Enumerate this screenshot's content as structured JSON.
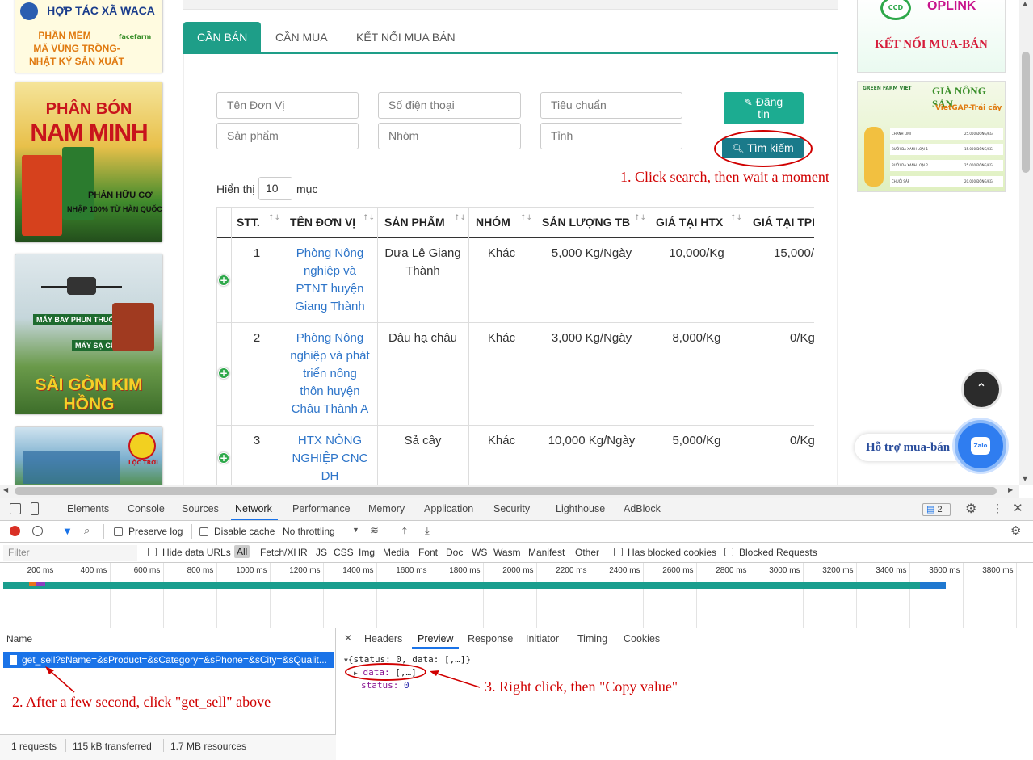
{
  "left_banners": [
    {
      "lines": [
        "HỢP TÁC XÃ WACA",
        "PHẦN MỀM",
        "MÃ VÙNG TRỒNG-",
        "NHẬT KÝ SẢN XUẤT",
        "facefarm"
      ]
    },
    {
      "lines": [
        "PHÂN BÓN",
        "NAM MINH",
        "PHÂN HỮU CƠ",
        "NHẬP 100% TỪ HÀN QUỐC"
      ]
    },
    {
      "lines": [
        "MÁY BAY PHUN THUỐC",
        "MÁY SẠ CỤM",
        "SÀI GÒN KIM HỒNG"
      ]
    },
    {
      "lines": [
        "LỘC TRỜI"
      ]
    }
  ],
  "right_banners": [
    {
      "lines": [
        "CCD",
        "OPLINK",
        "KẾT NỐI MUA-BÁN"
      ]
    },
    {
      "lines": [
        "GREEN FARM VIET",
        "GIÁ NÔNG SẢN",
        "VietGAP-Trái cây",
        "CHANH LIMI",
        "BƯỞI DA XANH LOẠI 1",
        "BƯỞI DA XANH LOẠI 2",
        "CHUỐI SÁP",
        "25.000 ĐỒNG/KG",
        "15.000 ĐỒNG/KG",
        "25.000 ĐỒNG/KG",
        "20.000 ĐỒNG/KG"
      ]
    }
  ],
  "tabs": [
    {
      "label": "CẦN BÁN",
      "active": true
    },
    {
      "label": "CẦN MUA",
      "active": false
    },
    {
      "label": "KẾT NỐI MUA BÁN",
      "active": false
    }
  ],
  "filters": {
    "unit_name": "Tên Đơn Vị",
    "phone": "Số điện thoại",
    "standard": "Tiêu chuẩn",
    "product": "Sản phẩm",
    "group": "Nhóm",
    "province": "Tỉnh"
  },
  "buttons": {
    "post_line1": "Đăng",
    "post_line2": "tin",
    "search": "Tìm kiếm"
  },
  "length_menu": {
    "prefix": "Hiển thị",
    "value": "10",
    "suffix": "mục"
  },
  "table": {
    "headers": [
      "STT.",
      "TÊN ĐƠN VỊ",
      "SẢN PHẨM",
      "NHÓM",
      "SẢN LƯỢNG TB",
      "GIÁ TẠI HTX",
      "GIÁ TẠI TPH"
    ],
    "rows": [
      {
        "stt": "1",
        "unit": [
          "Phòng Nông",
          "nghiệp và",
          "PTNT huyện",
          "Giang Thành"
        ],
        "product": [
          "Dưa Lê Giang",
          "Thành"
        ],
        "group": "Khác",
        "output": "5,000 Kg/Ngày",
        "price_htx": "10,000/Kg",
        "price_tph": "15,000/"
      },
      {
        "stt": "2",
        "unit": [
          "Phòng Nông",
          "nghiệp và phát",
          "triển nông",
          "thôn huyện",
          "Châu Thành A"
        ],
        "product": [
          "Dâu hạ châu"
        ],
        "group": "Khác",
        "output": "3,000 Kg/Ngày",
        "price_htx": "8,000/Kg",
        "price_tph": "0/Kg"
      },
      {
        "stt": "3",
        "unit": [
          "HTX NÔNG",
          "NGHIỆP CNC",
          "DH"
        ],
        "product": [
          "Sả cây"
        ],
        "group": "Khác",
        "output": "10,000 Kg/Ngày",
        "price_htx": "5,000/Kg",
        "price_tph": "0/Kg"
      }
    ]
  },
  "annotations": {
    "a1": "1. Click search, then wait a moment",
    "a2": "2. After a few second, click \"get_sell\" above",
    "a3": "3. Right click, then \"Copy value\""
  },
  "floating": {
    "support_label": "Hỗ trợ mua-bán",
    "zalo": "Zalo"
  },
  "devtools": {
    "tabs": [
      "Elements",
      "Console",
      "Sources",
      "Network",
      "Performance",
      "Memory",
      "Application",
      "Security",
      "Lighthouse",
      "AdBlock"
    ],
    "active_tab": "Network",
    "issues_count": "2",
    "toolbar": {
      "preserve_log": "Preserve log",
      "disable_cache": "Disable cache",
      "throttling": "No throttling"
    },
    "filter_placeholder": "Filter",
    "filter_types": [
      "Hide data URLs",
      "All",
      "Fetch/XHR",
      "JS",
      "CSS",
      "Img",
      "Media",
      "Font",
      "Doc",
      "WS",
      "Wasm",
      "Manifest",
      "Other"
    ],
    "blocked_cookies": "Has blocked cookies",
    "blocked_requests": "Blocked Requests",
    "ticks": [
      "200 ms",
      "400 ms",
      "600 ms",
      "800 ms",
      "1000 ms",
      "1200 ms",
      "1400 ms",
      "1600 ms",
      "1800 ms",
      "2000 ms",
      "2200 ms",
      "2400 ms",
      "2600 ms",
      "2800 ms",
      "3000 ms",
      "3200 ms",
      "3400 ms",
      "3600 ms",
      "3800 ms"
    ],
    "name_header": "Name",
    "request_name": "get_sell?sName=&sProduct=&sCategory=&sPhone=&sCity=&sQualit...",
    "detail_tabs": [
      "Headers",
      "Preview",
      "Response",
      "Initiator",
      "Timing",
      "Cookies"
    ],
    "detail_active": "Preview",
    "preview": {
      "root": "{status: 0, data: [,…]}",
      "data_key": "data",
      "data_val": "[,…]",
      "status_key": "status",
      "status_val": "0"
    },
    "status_bar": {
      "requests": "1 requests",
      "transferred": "115 kB transferred",
      "resources": "1.7 MB resources"
    }
  }
}
